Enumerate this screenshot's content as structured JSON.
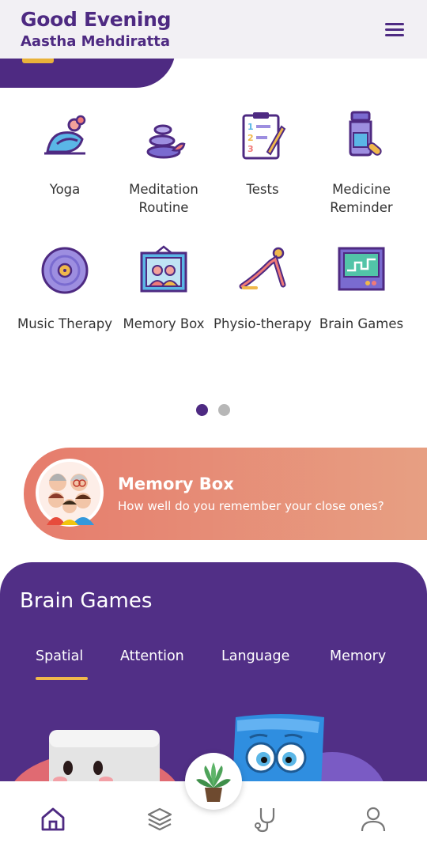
{
  "header": {
    "greeting": "Good Evening",
    "user_name": "Aastha Mehdiratta",
    "menu_icon": "hamburger-menu-icon"
  },
  "colors": {
    "brand_purple": "#4e2a82",
    "accent_yellow": "#f0b84b",
    "card_coral": "#e67c6c",
    "card_peach": "#e7a083"
  },
  "features": [
    {
      "label": "Yoga",
      "icon": "yoga-icon"
    },
    {
      "label": "Meditation Routine",
      "icon": "meditation-stones-icon"
    },
    {
      "label": "Tests",
      "icon": "clipboard-test-icon"
    },
    {
      "label": "Medicine Reminder",
      "icon": "medicine-bottle-icon"
    },
    {
      "label": "Music Therapy",
      "icon": "vinyl-record-icon"
    },
    {
      "label": "Memory Box",
      "icon": "photo-frame-icon"
    },
    {
      "label": "Physio-therapy",
      "icon": "physiotherapy-stretch-icon"
    },
    {
      "label": "Brain Games",
      "icon": "game-screen-icon"
    }
  ],
  "pager": {
    "pages": 2,
    "active": 1
  },
  "memory_card": {
    "title": "Memory Box",
    "subtitle": "How well do you remember your close ones?",
    "icon": "family-avatar-icon"
  },
  "brain_games": {
    "title": "Brain Games",
    "tabs": [
      "Spatial",
      "Attention",
      "Language",
      "Memory"
    ],
    "active_tab": "Spatial"
  },
  "bottom_nav": [
    {
      "icon": "home-icon",
      "active": true
    },
    {
      "icon": "layers-icon",
      "active": false
    },
    {
      "icon": "plant-icon",
      "active": false
    },
    {
      "icon": "stethoscope-icon",
      "active": false
    },
    {
      "icon": "profile-icon",
      "active": false
    }
  ]
}
